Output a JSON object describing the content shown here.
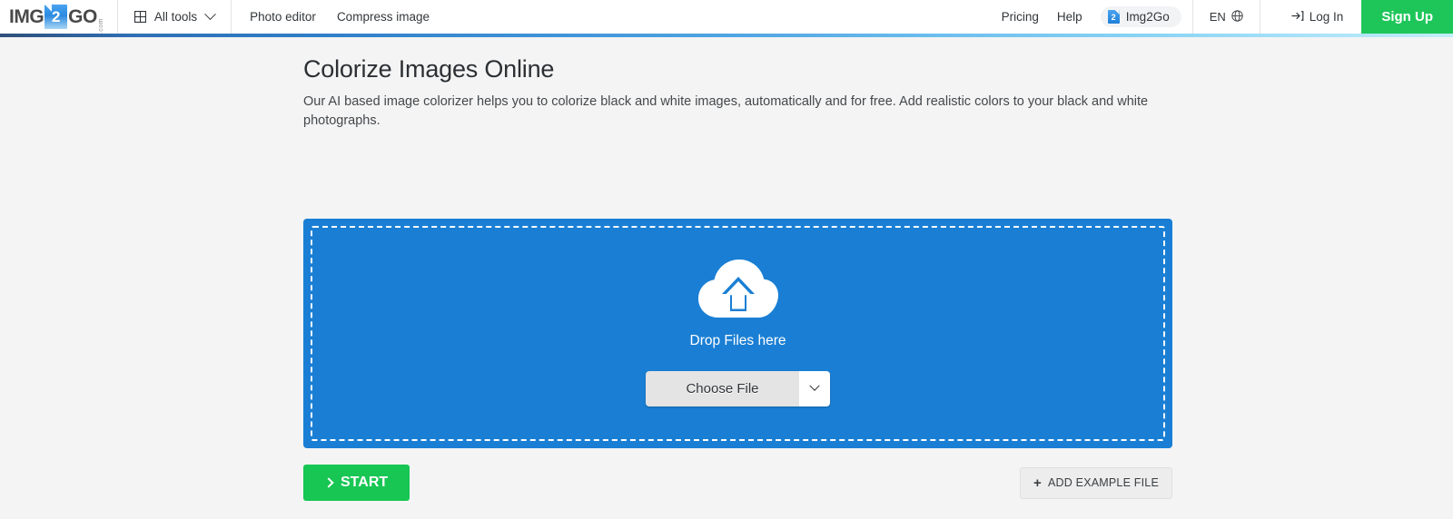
{
  "header": {
    "logo": {
      "left_text": "IMG",
      "badge_text": "2",
      "right_text": "GO",
      "domain_suffix": ".com"
    },
    "all_tools": {
      "label": "All tools",
      "icon": "grid-icon",
      "chevron": "chevron-down-icon"
    },
    "links": [
      {
        "label": "Photo editor"
      },
      {
        "label": "Compress image"
      }
    ],
    "right_links": [
      {
        "label": "Pricing"
      },
      {
        "label": "Help"
      }
    ],
    "brand_pill": {
      "label": "Img2Go",
      "badge_text": "2"
    },
    "language": {
      "label": "EN",
      "icon": "globe-icon"
    },
    "login": {
      "label": "Log In",
      "icon": "sign-in-icon"
    },
    "signup": {
      "label": "Sign Up"
    }
  },
  "main": {
    "title": "Colorize Images Online",
    "description": "Our AI based image colorizer helps you to colorize black and white images, automatically and for free. Add realistic colors to your black and white photographs."
  },
  "dropzone": {
    "icon": "cloud-upload-icon",
    "drop_label": "Drop Files here",
    "choose_file_label": "Choose File",
    "choose_file_chevron": "chevron-down-icon"
  },
  "actions": {
    "start_label": "START",
    "start_icon": "chevron-right-icon",
    "example_label": "ADD EXAMPLE FILE",
    "example_icon": "plus-icon"
  },
  "colors": {
    "brand_blue": "#1a7fd4",
    "green": "#1ec65a",
    "start_green": "#17c653",
    "page_bg": "#f4f4f4"
  }
}
